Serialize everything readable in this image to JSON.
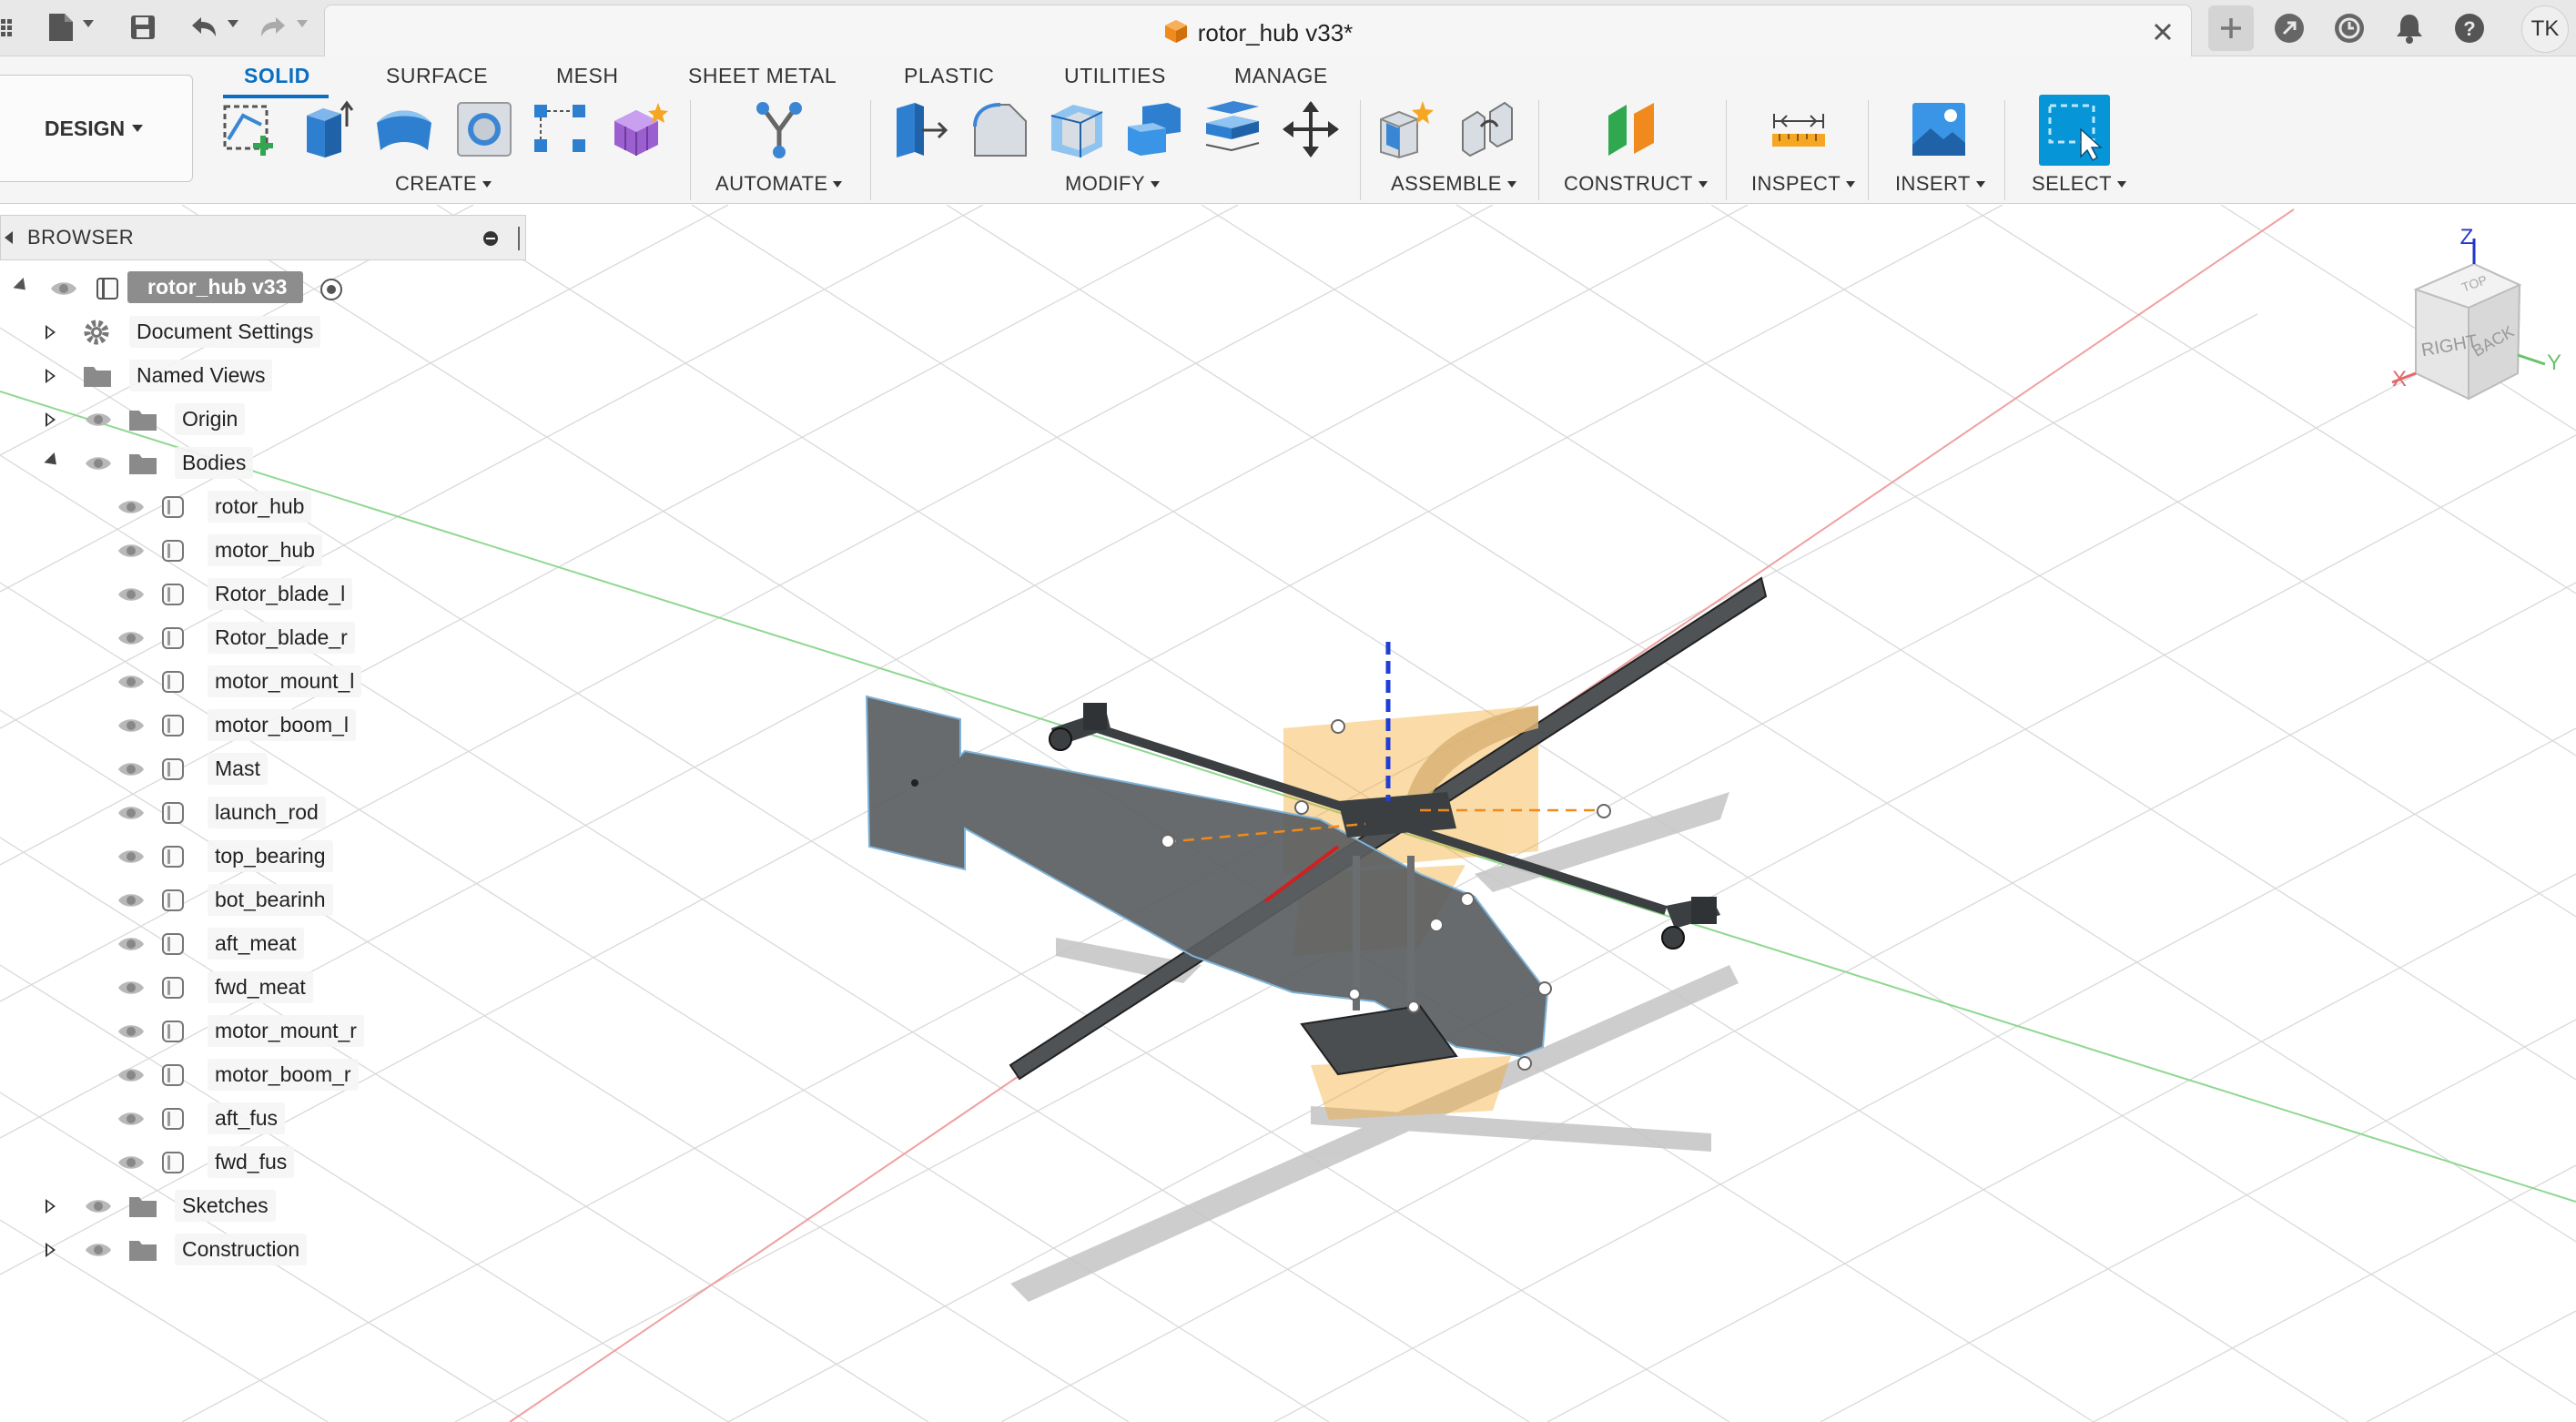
{
  "app": {
    "document_title": "rotor_hub v33*",
    "user_initials": "TK",
    "workspace_label": "DESIGN"
  },
  "ribbon": {
    "tabs": [
      "SOLID",
      "SURFACE",
      "MESH",
      "SHEET METAL",
      "PLASTIC",
      "UTILITIES",
      "MANAGE"
    ],
    "groups": {
      "create": "CREATE",
      "automate": "AUTOMATE",
      "modify": "MODIFY",
      "assemble": "ASSEMBLE",
      "construct": "CONSTRUCT",
      "inspect": "INSPECT",
      "insert": "INSERT",
      "select": "SELECT"
    }
  },
  "browser": {
    "title": "BROWSER",
    "root": "rotor_hub v33",
    "folders": {
      "document_settings": "Document Settings",
      "named_views": "Named Views",
      "origin": "Origin",
      "bodies": "Bodies",
      "sketches": "Sketches",
      "construction": "Construction"
    },
    "bodies": [
      "rotor_hub",
      "motor_hub",
      "Rotor_blade_l",
      "Rotor_blade_r",
      "motor_mount_l",
      "motor_boom_l",
      "Mast",
      "launch_rod",
      "top_bearing",
      "bot_bearinh",
      "aft_meat",
      "fwd_meat",
      "motor_mount_r",
      "motor_boom_r",
      "aft_fus",
      "fwd_fus"
    ]
  },
  "viewcube": {
    "axis_z": "Z",
    "axis_x": "X",
    "axis_y": "Y",
    "face_right": "RIGHT",
    "face_back": "BACK",
    "face_top": "TOP"
  },
  "colors": {
    "accent": "#0a6fc2",
    "selection_orange": "#f5a623",
    "body_gray": "#55595c",
    "x_axis": "#e06a6a",
    "y_axis": "#6bc26b",
    "z_axis": "#1f3fd6"
  }
}
